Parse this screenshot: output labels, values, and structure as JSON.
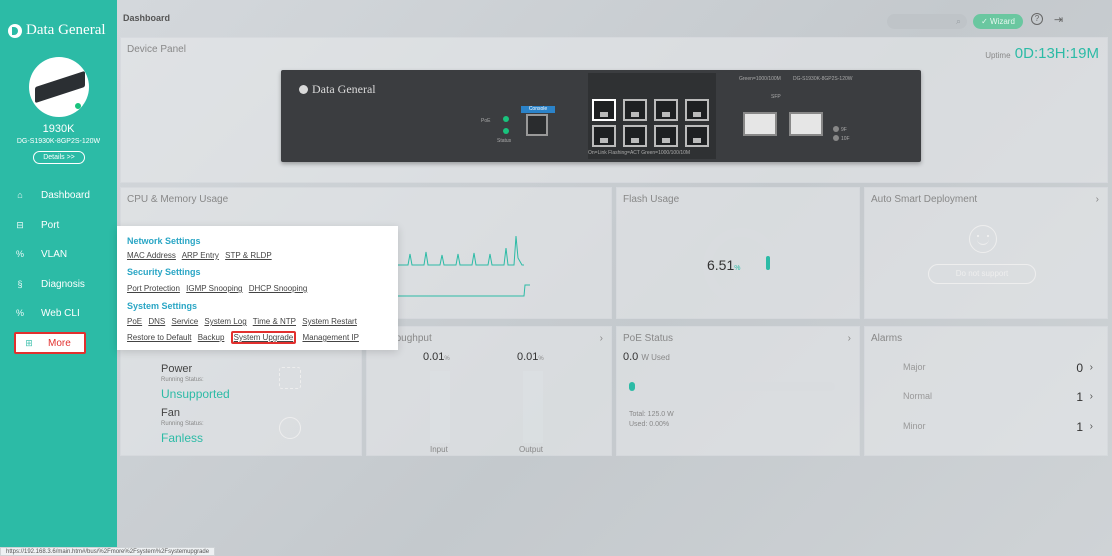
{
  "brand": "Data General",
  "device": {
    "name": "1930K",
    "model": "DG-S1930K-8GP2S-120W",
    "details_label": "Details >>"
  },
  "nav": [
    {
      "label": "Dashboard",
      "icon": "home-icon"
    },
    {
      "label": "Port",
      "icon": "port-icon"
    },
    {
      "label": "VLAN",
      "icon": "vlan-icon"
    },
    {
      "label": "Diagnosis",
      "icon": "diagnosis-icon"
    },
    {
      "label": "Web CLI",
      "icon": "cli-icon"
    },
    {
      "label": "More",
      "icon": "grid-icon"
    }
  ],
  "topbar": {
    "title": "Dashboard",
    "wizard_label": "Wizard"
  },
  "device_panel": {
    "title": "Device Panel",
    "uptime_label": "Uptime",
    "uptime_value": "0D:13H:19M",
    "switch_brand": "Data General",
    "console_label": "Console",
    "poe_label": "PoE",
    "status_label": "Status",
    "legend_top": "Green=1000/100M",
    "model_tag": "DG-S1930K-8GP2S-120W",
    "legend_bottom": "On=Link  Flashing=ACT  Green=1000/100/10M",
    "sfp_label": "SFP",
    "port_9f": "9F",
    "port_10f": "10F"
  },
  "cpu_panel": {
    "title": "CPU & Memory Usage"
  },
  "flash_panel": {
    "title": "Flash Usage",
    "value": "6.51",
    "unit": "%",
    "percent": 6.51
  },
  "auto_panel": {
    "title": "Auto Smart Deployment",
    "status": "Do not support"
  },
  "health_panel": {
    "power_label": "Power",
    "power_sub": "Running Status:",
    "power_value": "Unsupported",
    "fan_label": "Fan",
    "fan_sub": "Running Status:",
    "fan_value": "Fanless"
  },
  "traffic_panel": {
    "title": "c Throughput",
    "input_value": "0.01",
    "output_value": "0.01",
    "unit": "%",
    "input_label": "Input",
    "output_label": "Output"
  },
  "poe_panel": {
    "title": "PoE Status",
    "used_value": "0.0",
    "used_unit": "W Used",
    "total": "Total: 125.0 W",
    "used_pct": "Used: 0.00%",
    "percent": 0.0
  },
  "alarms_panel": {
    "title": "Alarms",
    "rows": [
      {
        "label": "Major",
        "value": "0"
      },
      {
        "label": "Normal",
        "value": "1"
      },
      {
        "label": "Minor",
        "value": "1"
      }
    ]
  },
  "more_menu": {
    "network_title": "Network Settings",
    "network_items": [
      "MAC Address",
      "ARP Entry",
      "STP & RLDP"
    ],
    "security_title": "Security Settings",
    "security_items": [
      "Port Protection",
      "IGMP Snooping",
      "DHCP Snooping"
    ],
    "system_title": "System Settings",
    "system_items_1": [
      "PoE",
      "DNS",
      "Service",
      "System Log",
      "Time & NTP",
      "System Restart"
    ],
    "system_items_2": [
      "Restore to Default",
      "Backup",
      "System Upgrade",
      "Management IP"
    ]
  },
  "status_url": "https://192.168.3.6/main.htm#/bus/%2Fmore%2Fsystem%2Fsystemupgrade",
  "colors": {
    "accent": "#2cbba6",
    "highlight": "#e2302e",
    "menu_header": "#2aa6c5"
  }
}
